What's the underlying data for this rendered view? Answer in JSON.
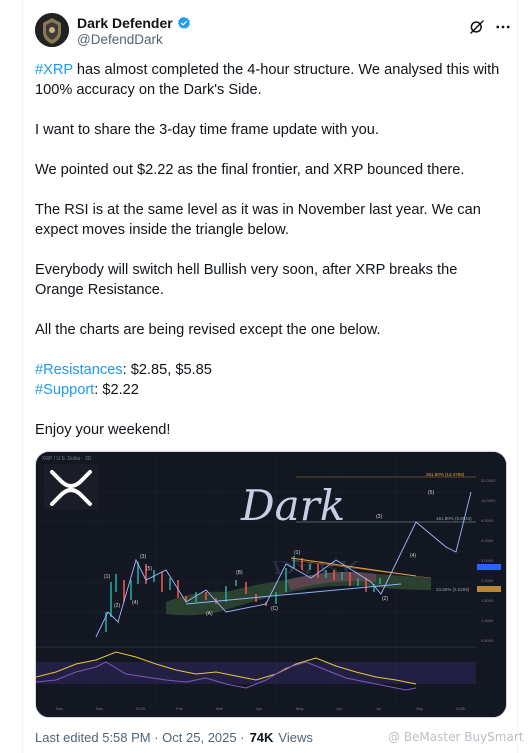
{
  "author": {
    "name": "Dark Defender",
    "handle": "@DefendDark",
    "verified_color": "#1d9bf0"
  },
  "tweet": {
    "paragraphs": [
      {
        "parts": [
          {
            "text": "#XRP",
            "link": true
          },
          {
            "text": " has almost completed the 4-hour structure. We analysed this with 100% accuracy on the Dark's Side.",
            "link": false
          }
        ]
      },
      {
        "parts": [
          {
            "text": "I want to share the 3-day time frame update with you.",
            "link": false
          }
        ]
      },
      {
        "parts": [
          {
            "text": "We pointed out $2.22 as the final frontier, and XRP bounced there.",
            "link": false
          }
        ]
      },
      {
        "parts": [
          {
            "text": "The RSI is at the same level as it was in November last year. We can expect moves inside the triangle below.",
            "link": false
          }
        ]
      },
      {
        "parts": [
          {
            "text": "Everybody will switch hell Bullish very soon, after XRP breaks the Orange Resistance.",
            "link": false
          }
        ]
      },
      {
        "parts": [
          {
            "text": "All the charts are being revised except the one below.",
            "link": false
          }
        ]
      },
      {
        "lines": [
          [
            {
              "text": "#Resistances",
              "link": true
            },
            {
              "text": ": $2.85, $5.85",
              "link": false
            }
          ],
          [
            {
              "text": "#Support",
              "link": true
            },
            {
              "text": ": $2.22",
              "link": false
            }
          ]
        ]
      },
      {
        "parts": [
          {
            "text": "Enjoy your weekend!",
            "link": false
          }
        ]
      }
    ],
    "link_color": "#1d9bf0"
  },
  "media": {
    "chart_header": "XRP / U.S. Dollar · 3D",
    "watermark_word": "Dark",
    "fib_top_label": "261.80% (13.4789)",
    "fib_mid_label": "161.80% (5.8543)",
    "fib_low_label": "23.60% (2.2269)",
    "wave_labels": [
      "(1)",
      "(2)",
      "(3)",
      "(4)",
      "(5)",
      "(A)",
      "(B)",
      "(C)",
      "(1)",
      "(2)",
      "(3)",
      "(4)",
      "(5)"
    ],
    "accent_orange": "#e8a23a",
    "accent_blue": "#8ab4f8"
  },
  "footer": {
    "edited": "Last edited 5:58 PM · Oct 25, 2025 ·",
    "views_count": "74K",
    "views_label": "Views",
    "watermark": "@ BeMaster BuySmart"
  }
}
